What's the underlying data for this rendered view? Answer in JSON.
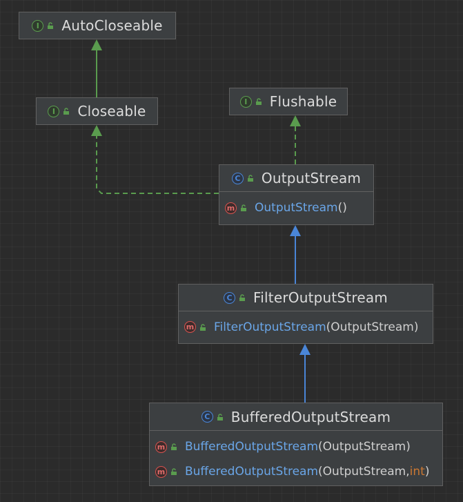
{
  "diagram": {
    "nodes": {
      "autocloseable": {
        "kind": "interface",
        "badge": "I",
        "name": "AutoCloseable"
      },
      "closeable": {
        "kind": "interface",
        "badge": "I",
        "name": "Closeable"
      },
      "flushable": {
        "kind": "interface",
        "badge": "I",
        "name": "Flushable"
      },
      "outputstream": {
        "kind": "class",
        "badge": "C",
        "name": "OutputStream",
        "members": [
          {
            "badge": "m",
            "name": "OutputStream",
            "sig": "()"
          }
        ]
      },
      "filteroutputstream": {
        "kind": "class",
        "badge": "C",
        "name": "FilterOutputStream",
        "members": [
          {
            "badge": "m",
            "name": "FilterOutputStream",
            "sig": "(OutputStream)"
          }
        ]
      },
      "bufferedoutputstream": {
        "kind": "class",
        "badge": "C",
        "name": "BufferedOutputStream",
        "members": [
          {
            "badge": "m",
            "name": "BufferedOutputStream",
            "sig": "(OutputStream)"
          },
          {
            "badge": "m",
            "name": "BufferedOutputStream",
            "sig_pre": "(OutputStream, ",
            "sig_kw": "int",
            "sig_post": ")"
          }
        ]
      }
    },
    "edges": [
      {
        "from": "Closeable",
        "to": "AutoCloseable",
        "type": "extends"
      },
      {
        "from": "OutputStream",
        "to": "Closeable",
        "type": "implements"
      },
      {
        "from": "OutputStream",
        "to": "Flushable",
        "type": "implements"
      },
      {
        "from": "FilterOutputStream",
        "to": "OutputStream",
        "type": "extends"
      },
      {
        "from": "BufferedOutputStream",
        "to": "FilterOutputStream",
        "type": "extends"
      }
    ],
    "colors": {
      "background": "#2b2b2b",
      "interface_edge": "#5a9c4e",
      "class_edge": "#4a86d8",
      "node_fill": "#3c3f41",
      "node_border": "#616161",
      "method_name": "#6aa6e8",
      "keyword": "#cc7832"
    },
    "icons": {
      "interface": "interface-badge-icon",
      "class": "class-badge-icon",
      "method": "method-badge-icon",
      "visibility": "public-lock-icon"
    }
  }
}
